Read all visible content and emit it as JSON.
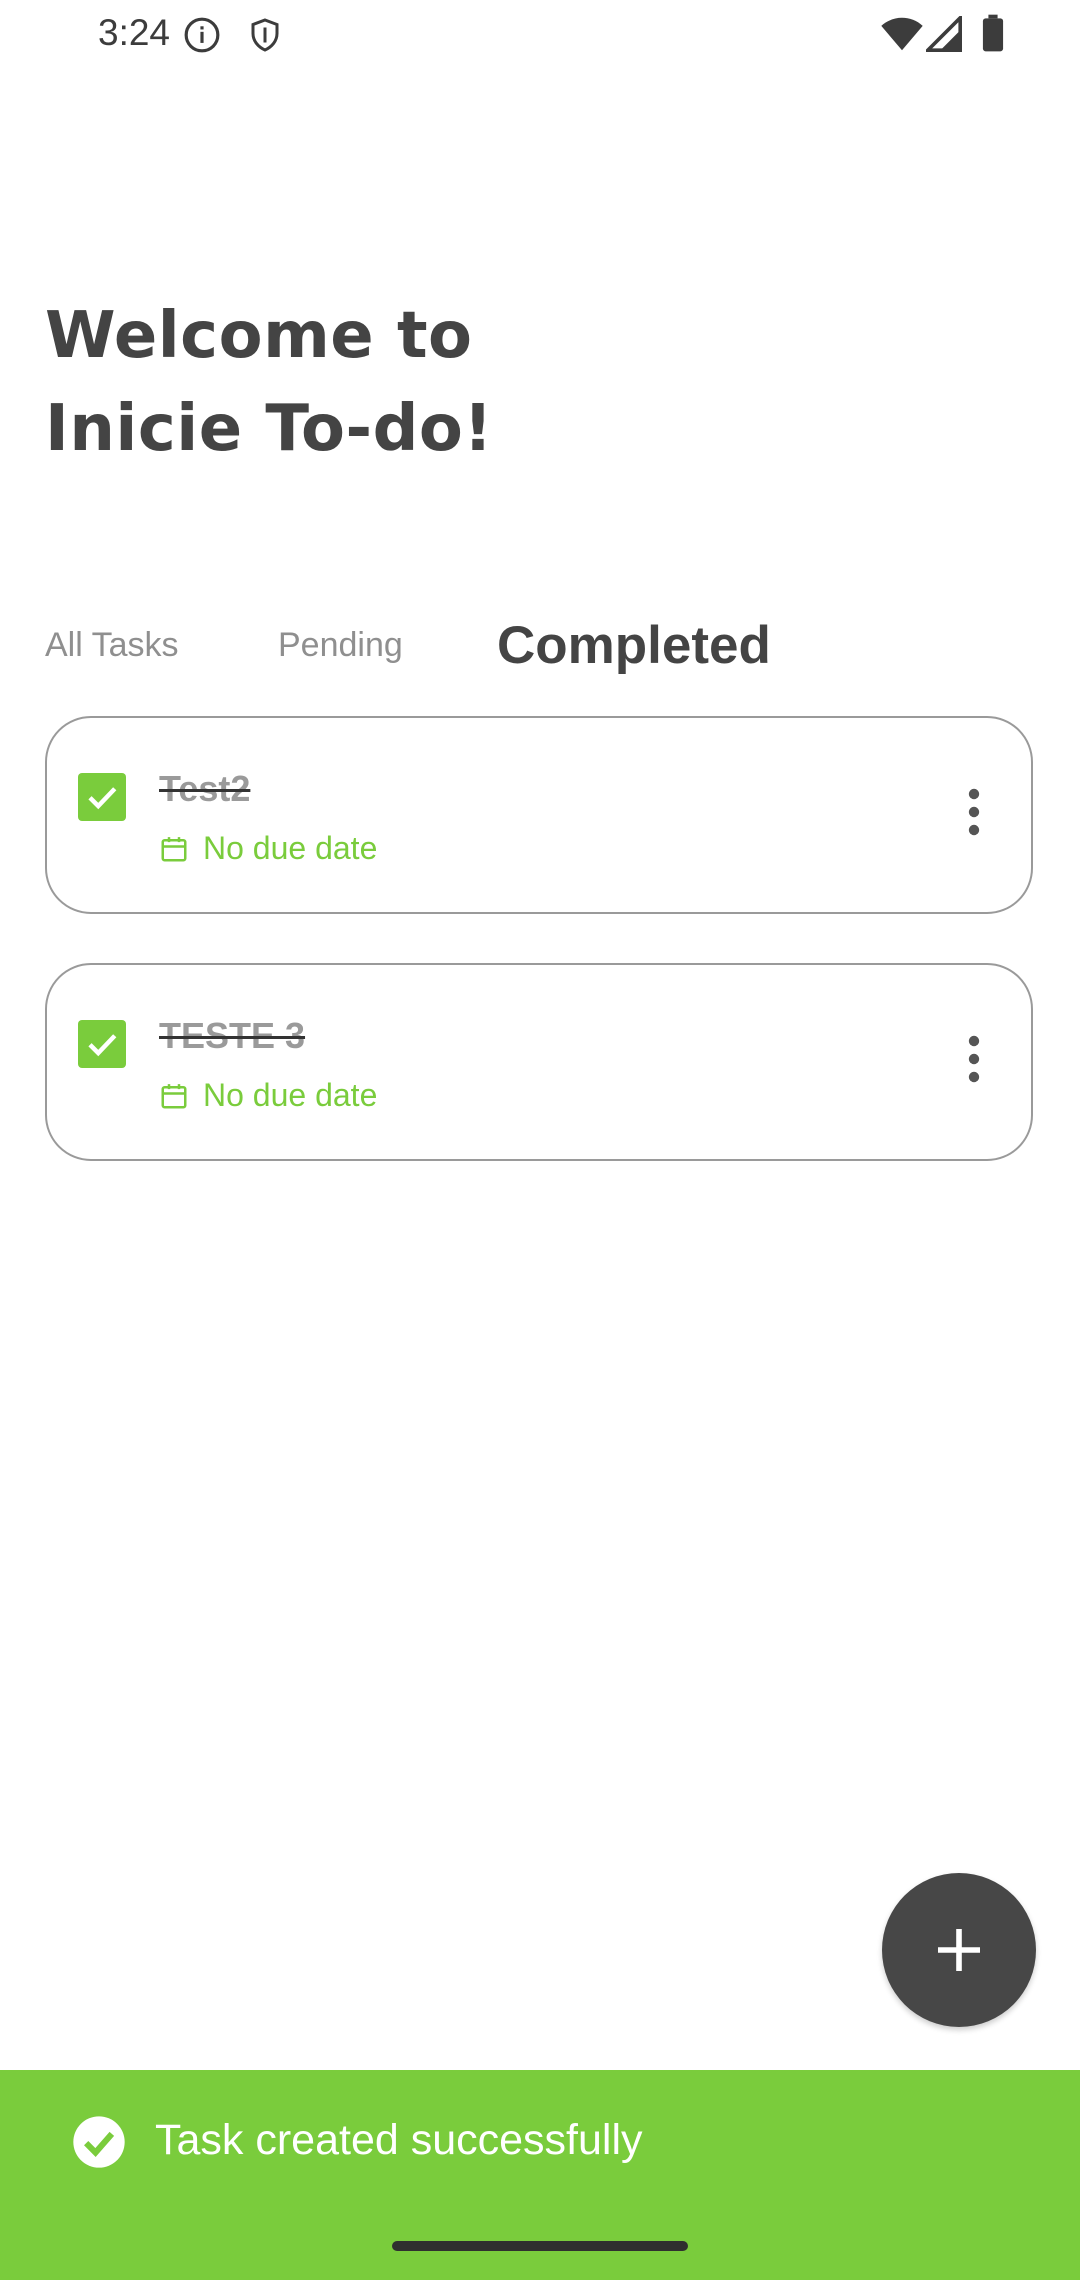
{
  "status_bar": {
    "time": "3:24",
    "icons": [
      "info-icon",
      "shield-icon",
      "wifi-icon",
      "signal-icon",
      "battery-icon"
    ]
  },
  "header": {
    "title_line1": "Welcome to",
    "title_line2": "Inicie To-do!"
  },
  "tabs": [
    {
      "label": "All Tasks",
      "selected": false
    },
    {
      "label": "Pending",
      "selected": false
    },
    {
      "label": "Completed",
      "selected": true
    }
  ],
  "tasks": [
    {
      "title": "Test2",
      "due": "No due date",
      "completed": true
    },
    {
      "title": "TESTE 3",
      "due": "No due date",
      "completed": true
    }
  ],
  "fab": {
    "icon": "plus-icon"
  },
  "snackbar": {
    "message": "Task created successfully",
    "icon": "check-circle-icon"
  },
  "colors": {
    "accent": "#7acc3c",
    "title": "#444444",
    "muted": "#8f8f8f",
    "fab": "#474747"
  }
}
